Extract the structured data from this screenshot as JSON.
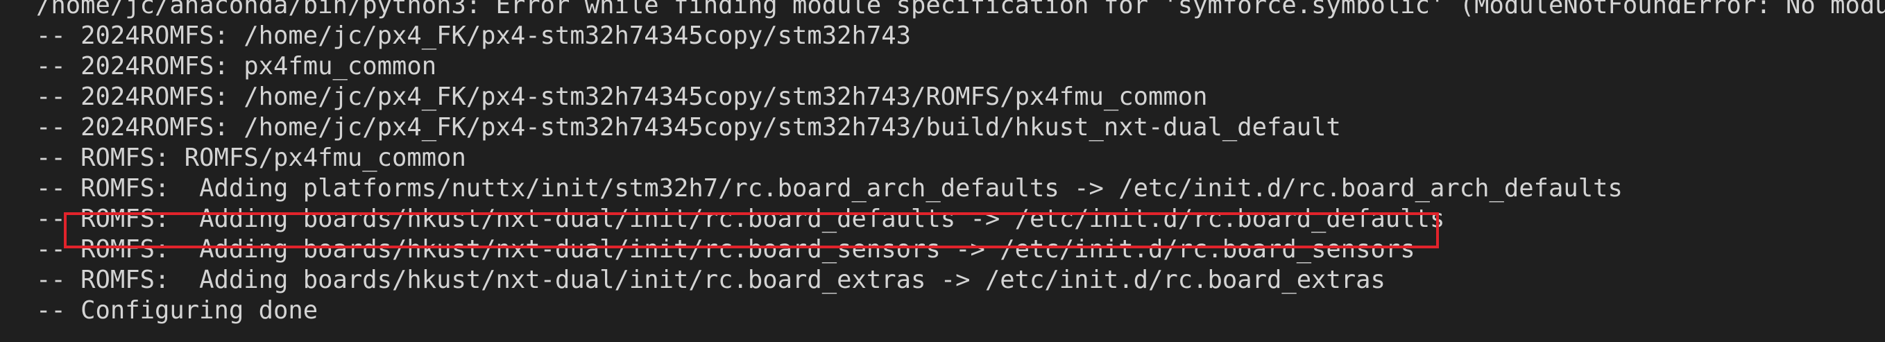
{
  "terminal": {
    "lines": [
      "/home/jc/anaconda/bin/python3: Error while finding module specification for 'symforce.symbolic' (ModuleNotFoundError: No module named 'symforce')",
      "-- 2024ROMFS: /home/jc/px4_FK/px4-stm32h74345copy/stm32h743",
      "-- 2024ROMFS: px4fmu_common",
      "-- 2024ROMFS: /home/jc/px4_FK/px4-stm32h74345copy/stm32h743/ROMFS/px4fmu_common",
      "-- 2024ROMFS: /home/jc/px4_FK/px4-stm32h74345copy/stm32h743/build/hkust_nxt-dual_default",
      "-- ROMFS: ROMFS/px4fmu_common",
      "-- ROMFS:  Adding platforms/nuttx/init/stm32h7/rc.board_arch_defaults -> /etc/init.d/rc.board_arch_defaults",
      "-- ROMFS:  Adding boards/hkust/nxt-dual/init/rc.board_defaults -> /etc/init.d/rc.board_defaults",
      "-- ROMFS:  Adding boards/hkust/nxt-dual/init/rc.board_sensors -> /etc/init.d/rc.board_sensors",
      "-- ROMFS:  Adding boards/hkust/nxt-dual/init/rc.board_extras -> /etc/init.d/rc.board_extras",
      "-- Configuring done"
    ],
    "highlighted_line_index": 7,
    "colors": {
      "background": "#1f1f1f",
      "text": "#d4d4d4",
      "highlight_border": "#e1232b"
    }
  }
}
